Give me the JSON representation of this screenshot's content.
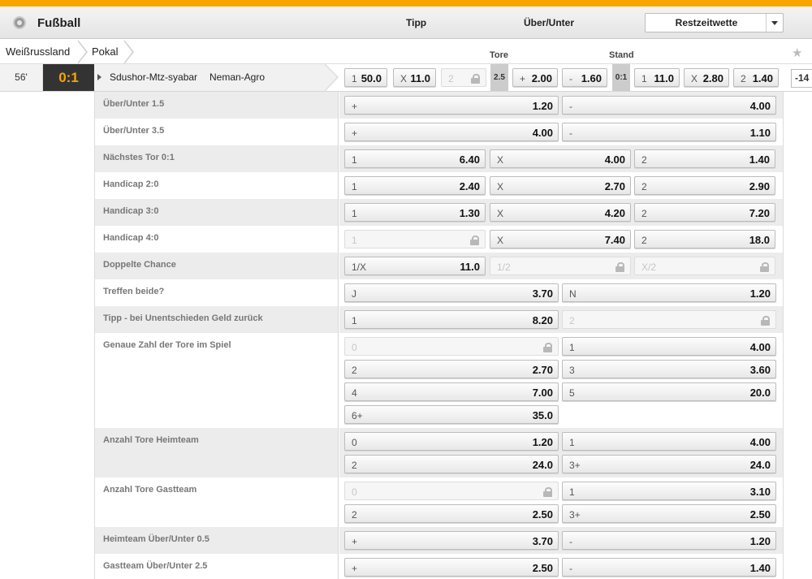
{
  "header": {
    "sport": "Fußball",
    "col_tipp": "Tipp",
    "col_ou": "Über/Unter",
    "dropdown": "Restzeitwette"
  },
  "breadcrumb": [
    "Weißrussland",
    "Pokal"
  ],
  "subheader": {
    "tore": "Tore",
    "stand": "Stand"
  },
  "match": {
    "minute": "56'",
    "score": "0:1",
    "team1": "Sdushor-Mtz-syabar",
    "team2": "Neman-Agro",
    "tipp": [
      {
        "label": "1",
        "value": "50.0",
        "locked": false
      },
      {
        "label": "X",
        "value": "11.0",
        "locked": false
      },
      {
        "label": "2",
        "value": "",
        "locked": true
      }
    ],
    "tore_line": "2.5",
    "ou": [
      {
        "label": "+",
        "value": "2.00"
      },
      {
        "label": "-",
        "value": "1.60"
      }
    ],
    "stand_tag": "0:1",
    "rest": [
      {
        "label": "1",
        "value": "11.0"
      },
      {
        "label": "X",
        "value": "2.80"
      },
      {
        "label": "2",
        "value": "1.40"
      }
    ],
    "more": "-14"
  },
  "markets": [
    {
      "name": "Über/Unter 1.5",
      "rows": [
        [
          {
            "l": "+",
            "v": "1.20"
          },
          {
            "l": "-",
            "v": "4.00"
          }
        ]
      ]
    },
    {
      "name": "Über/Unter 3.5",
      "rows": [
        [
          {
            "l": "+",
            "v": "4.00"
          },
          {
            "l": "-",
            "v": "1.10"
          }
        ]
      ]
    },
    {
      "name": "Nächstes Tor 0:1",
      "rows": [
        [
          {
            "l": "1",
            "v": "6.40"
          },
          {
            "l": "X",
            "v": "4.00"
          },
          {
            "l": "2",
            "v": "1.40"
          }
        ]
      ]
    },
    {
      "name": "Handicap 2:0",
      "rows": [
        [
          {
            "l": "1",
            "v": "2.40"
          },
          {
            "l": "X",
            "v": "2.70"
          },
          {
            "l": "2",
            "v": "2.90"
          }
        ]
      ]
    },
    {
      "name": "Handicap 3:0",
      "rows": [
        [
          {
            "l": "1",
            "v": "1.30"
          },
          {
            "l": "X",
            "v": "4.20"
          },
          {
            "l": "2",
            "v": "7.20"
          }
        ]
      ]
    },
    {
      "name": "Handicap 4:0",
      "rows": [
        [
          {
            "l": "1",
            "v": "",
            "locked": true
          },
          {
            "l": "X",
            "v": "7.40"
          },
          {
            "l": "2",
            "v": "18.0"
          }
        ]
      ]
    },
    {
      "name": "Doppelte Chance",
      "rows": [
        [
          {
            "l": "1/X",
            "v": "11.0"
          },
          {
            "l": "1/2",
            "v": "",
            "locked": true
          },
          {
            "l": "X/2",
            "v": "",
            "locked": true
          }
        ]
      ]
    },
    {
      "name": "Treffen beide?",
      "rows": [
        [
          {
            "l": "J",
            "v": "3.70"
          },
          {
            "l": "N",
            "v": "1.20"
          }
        ]
      ]
    },
    {
      "name": "Tipp - bei Unentschieden Geld zurück",
      "rows": [
        [
          {
            "l": "1",
            "v": "8.20"
          },
          {
            "l": "2",
            "v": "",
            "locked": true
          }
        ]
      ]
    },
    {
      "name": "Genaue Zahl der Tore im Spiel",
      "rows": [
        [
          {
            "l": "0",
            "v": "",
            "locked": true
          },
          {
            "l": "1",
            "v": "4.00"
          }
        ],
        [
          {
            "l": "2",
            "v": "2.70"
          },
          {
            "l": "3",
            "v": "3.60"
          }
        ],
        [
          {
            "l": "4",
            "v": "7.00"
          },
          {
            "l": "5",
            "v": "20.0"
          }
        ],
        [
          {
            "l": "6+",
            "v": "35.0"
          }
        ]
      ]
    },
    {
      "name": "Anzahl Tore Heimteam",
      "rows": [
        [
          {
            "l": "0",
            "v": "1.20"
          },
          {
            "l": "1",
            "v": "4.00"
          }
        ],
        [
          {
            "l": "2",
            "v": "24.0"
          },
          {
            "l": "3+",
            "v": "24.0"
          }
        ]
      ]
    },
    {
      "name": "Anzahl Tore Gastteam",
      "rows": [
        [
          {
            "l": "0",
            "v": "",
            "locked": true
          },
          {
            "l": "1",
            "v": "3.10"
          }
        ],
        [
          {
            "l": "2",
            "v": "2.50"
          },
          {
            "l": "3+",
            "v": "2.50"
          }
        ]
      ]
    },
    {
      "name": "Heimteam Über/Unter 0.5",
      "rows": [
        [
          {
            "l": "+",
            "v": "3.70"
          },
          {
            "l": "-",
            "v": "1.20"
          }
        ]
      ]
    },
    {
      "name": "Gastteam Über/Unter 2.5",
      "rows": [
        [
          {
            "l": "+",
            "v": "2.50"
          },
          {
            "l": "-",
            "v": "1.40"
          }
        ]
      ]
    }
  ]
}
